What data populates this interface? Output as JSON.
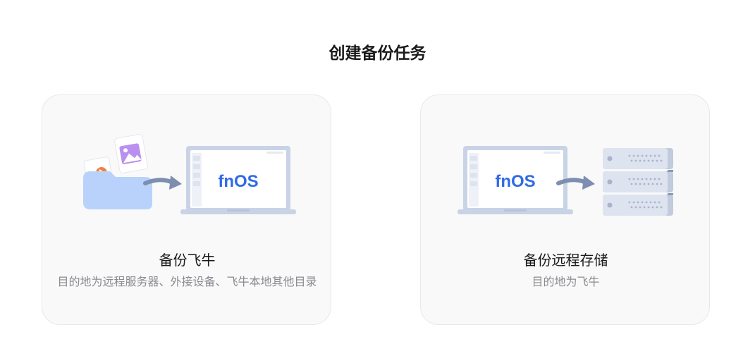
{
  "page": {
    "title": "创建备份任务"
  },
  "cards": [
    {
      "title": "备份飞牛",
      "description": "目的地为远程服务器、外接设备、飞牛本地其他目录",
      "screen_text": "fnOS"
    },
    {
      "title": "备份远程存储",
      "description": "目的地为飞牛",
      "screen_text": "fnOS"
    }
  ],
  "colors": {
    "accent": "#2f6be6",
    "folder": "#b9d2fb",
    "laptop_frame": "#c9d3e6",
    "arrow": "#7d8eb0",
    "server": "#dde3ef"
  },
  "icons": [
    "folder-icon",
    "document-icon",
    "video-icon",
    "image-icon",
    "laptop-icon",
    "arrow-icon",
    "server-icon"
  ]
}
